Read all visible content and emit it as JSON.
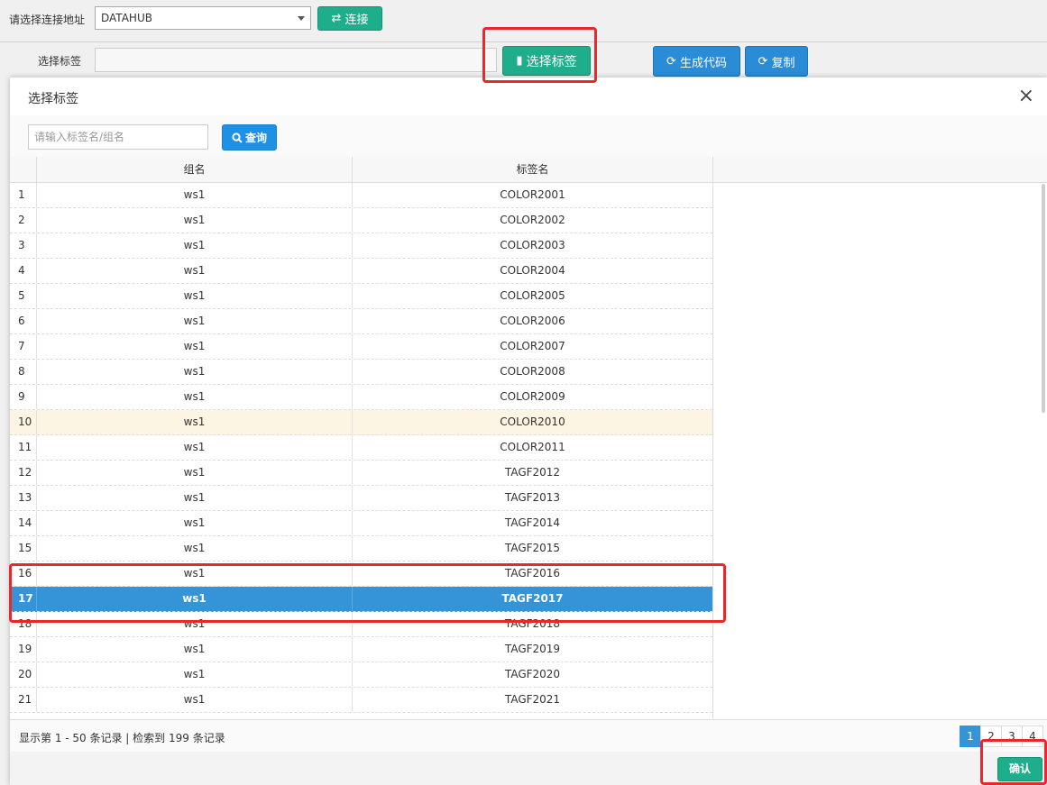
{
  "form": {
    "addr_label": "请选择连接地址",
    "addr_value": "DATAHUB",
    "connect_label": "连接",
    "tag_label": "选择标签",
    "select_tag_label": "选择标签",
    "gen_code_label": "生成代码",
    "copy_label": "复制"
  },
  "modal": {
    "title": "选择标签",
    "close": "×",
    "search_placeholder": "请输入标签名/组名",
    "search_label": "查询",
    "columns": [
      "组名",
      "标签名"
    ],
    "rows": [
      {
        "n": "1",
        "group": "ws1",
        "tag": "COLOR2001"
      },
      {
        "n": "2",
        "group": "ws1",
        "tag": "COLOR2002"
      },
      {
        "n": "3",
        "group": "ws1",
        "tag": "COLOR2003"
      },
      {
        "n": "4",
        "group": "ws1",
        "tag": "COLOR2004"
      },
      {
        "n": "5",
        "group": "ws1",
        "tag": "COLOR2005"
      },
      {
        "n": "6",
        "group": "ws1",
        "tag": "COLOR2006"
      },
      {
        "n": "7",
        "group": "ws1",
        "tag": "COLOR2007"
      },
      {
        "n": "8",
        "group": "ws1",
        "tag": "COLOR2008"
      },
      {
        "n": "9",
        "group": "ws1",
        "tag": "COLOR2009"
      },
      {
        "n": "10",
        "group": "ws1",
        "tag": "COLOR2010"
      },
      {
        "n": "11",
        "group": "ws1",
        "tag": "COLOR2011"
      },
      {
        "n": "12",
        "group": "ws1",
        "tag": "TAGF2012"
      },
      {
        "n": "13",
        "group": "ws1",
        "tag": "TAGF2013"
      },
      {
        "n": "14",
        "group": "ws1",
        "tag": "TAGF2014"
      },
      {
        "n": "15",
        "group": "ws1",
        "tag": "TAGF2015"
      },
      {
        "n": "16",
        "group": "ws1",
        "tag": "TAGF2016"
      },
      {
        "n": "17",
        "group": "ws1",
        "tag": "TAGF2017"
      },
      {
        "n": "18",
        "group": "ws1",
        "tag": "TAGF2018"
      },
      {
        "n": "19",
        "group": "ws1",
        "tag": "TAGF2019"
      },
      {
        "n": "20",
        "group": "ws1",
        "tag": "TAGF2020"
      },
      {
        "n": "21",
        "group": "ws1",
        "tag": "TAGF2021"
      }
    ],
    "hover_row": "10",
    "selected_row": "17",
    "footer_info": "显示第 1 - 50 条记录 | 检索到 199 条记录",
    "pages": [
      "1",
      "2",
      "3",
      "4"
    ],
    "active_page": "1",
    "confirm_label": "确认"
  },
  "colors": {
    "teal": "#1fae8b",
    "blue": "#2a8bd6",
    "selected_row": "#3593d8",
    "annotation": "#e8282b"
  }
}
